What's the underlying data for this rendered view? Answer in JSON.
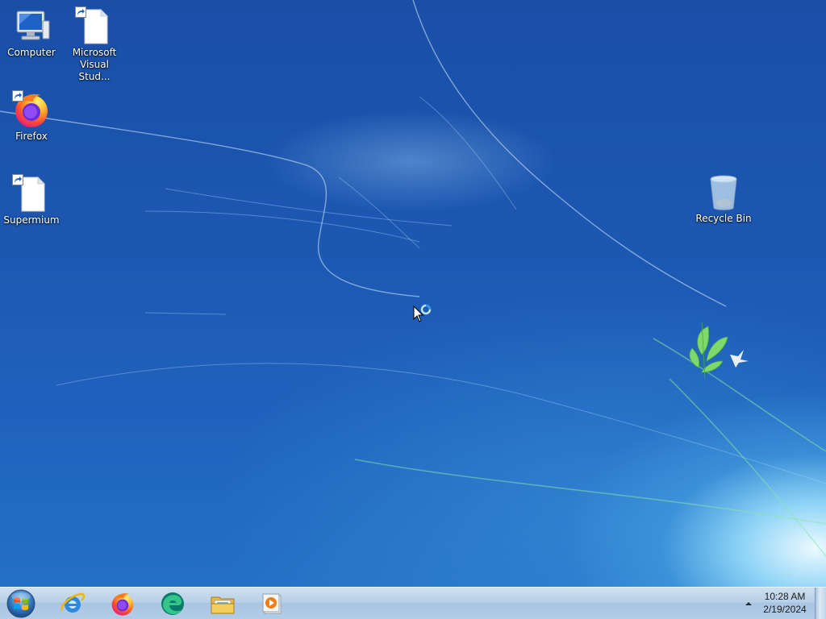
{
  "desktop": {
    "icons": [
      {
        "name": "Computer",
        "icon": "computer-icon"
      },
      {
        "name": "Microsoft Visual Stud...",
        "line1": "Microsoft",
        "line2": "Visual Stud...",
        "icon": "document-shortcut-icon"
      },
      {
        "name": "Firefox",
        "icon": "firefox-icon"
      },
      {
        "name": "Supermium",
        "icon": "document-shortcut-icon"
      },
      {
        "name": "Recycle Bin",
        "icon": "recycle-bin-icon"
      }
    ]
  },
  "taskbar": {
    "start_button": "start-orb-icon",
    "pinned": [
      {
        "app": "internet-explorer-icon"
      },
      {
        "app": "firefox-icon"
      },
      {
        "app": "edge-icon"
      },
      {
        "app": "file-explorer-icon"
      },
      {
        "app": "media-player-icon"
      }
    ],
    "clock": {
      "time": "10:28 AM",
      "date": "2/19/2024"
    }
  },
  "colors": {
    "wallpaper": "#1c57b1",
    "taskbar": "#b8d0e8",
    "text_light": "#ffffff"
  }
}
